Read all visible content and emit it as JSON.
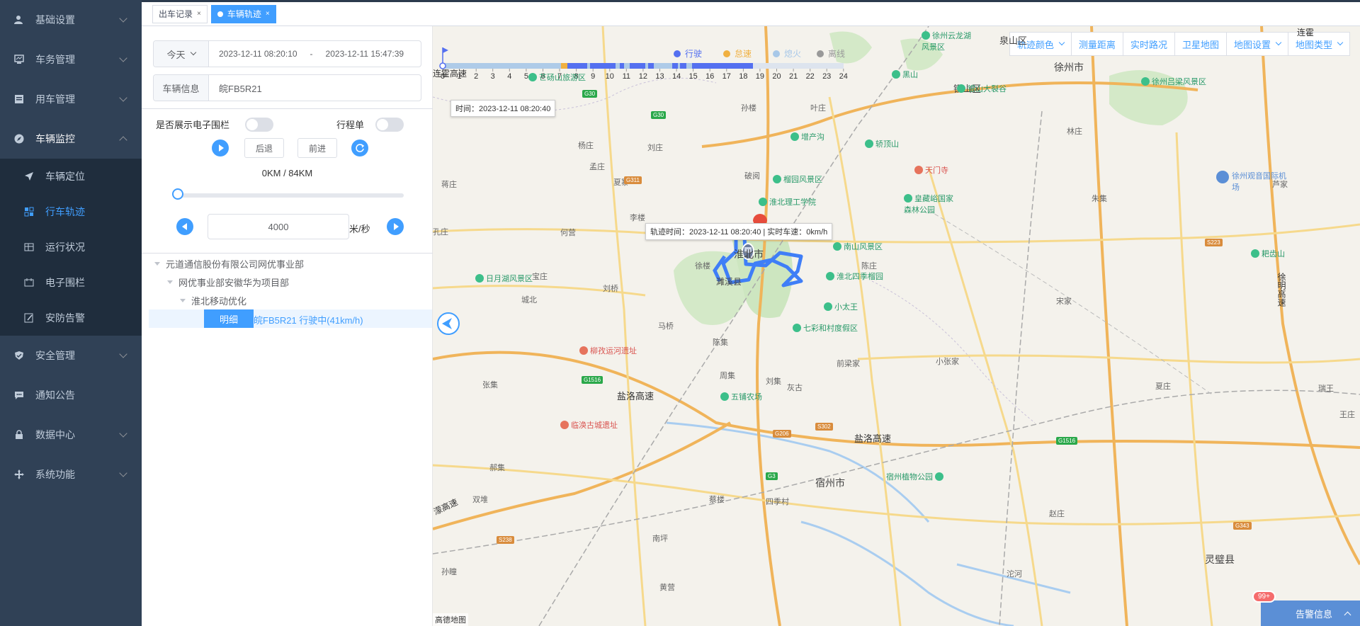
{
  "sidebar": {
    "menu": [
      {
        "label": "基础设置",
        "icon": "user-icon"
      },
      {
        "label": "车务管理",
        "icon": "monitor-icon"
      },
      {
        "label": "用车管理",
        "icon": "document-icon"
      },
      {
        "label": "车辆监控",
        "icon": "compass-icon"
      }
    ],
    "submenu": [
      {
        "label": "车辆定位",
        "icon": "send-icon"
      },
      {
        "label": "行车轨迹",
        "icon": "grid-icon"
      },
      {
        "label": "运行状况",
        "icon": "table-icon"
      },
      {
        "label": "电子围栏",
        "icon": "fence-icon"
      },
      {
        "label": "安防告警",
        "icon": "edit-icon"
      }
    ],
    "menu_bottom": [
      {
        "label": "安全管理",
        "icon": "shield-icon"
      },
      {
        "label": "通知公告",
        "icon": "chat-icon"
      },
      {
        "label": "数据中心",
        "icon": "lock-icon"
      },
      {
        "label": "系统功能",
        "icon": "move-icon"
      }
    ]
  },
  "tabs": [
    {
      "label": "出车记录",
      "close": "×"
    },
    {
      "label": "车辆轨迹",
      "close": "×"
    }
  ],
  "panel": {
    "date_prefix": "今天",
    "date_start": "2023-12-11 08:20:10",
    "date_sep": "-",
    "date_end": "2023-12-11 15:47:39",
    "vehicle_prefix": "车辆信息",
    "vehicle_value": "皖FB5R21",
    "fence_label": "是否展示电子围栏",
    "trip_label": "行程单",
    "back_label": "后退",
    "forward_label": "前进",
    "distance": "0KM / 84KM",
    "speed_value": "4000",
    "speed_unit": "米/秒",
    "tree": {
      "l1": "元道通信股份有限公司网优事业部",
      "l2": "网优事业部安徽华为项目部",
      "l3": "淮北移动优化",
      "detail_btn": "明细",
      "vehicle": "皖FB5R21 行驶中(41km/h)"
    }
  },
  "map": {
    "legend": [
      {
        "label": "行驶",
        "color": "#5470f0"
      },
      {
        "label": "怠速",
        "color": "#f0b040"
      },
      {
        "label": "熄火",
        "color": "#a8c8e8"
      },
      {
        "label": "离线",
        "color": "#999999"
      }
    ],
    "timeline_hours": [
      "0",
      "1",
      "2",
      "3",
      "4",
      "5",
      "6",
      "7",
      "8",
      "9",
      "10",
      "11",
      "12",
      "13",
      "14",
      "15",
      "16",
      "17",
      "18",
      "19",
      "20",
      "21",
      "22",
      "23",
      "24"
    ],
    "current_time_tip": "时间：2023-12-11 08:20:40",
    "track_tip": "轨迹时间：2023-12-11 08:20:40 | 实时车速：0km/h",
    "toolbar": {
      "track_color": "轨迹颜色",
      "measure": "测量距离",
      "traffic": "实时路况",
      "satellite": "卫星地图",
      "settings": "地图设置",
      "map_type": "地图类型"
    },
    "places": {
      "xuzhou": "徐州市",
      "suzhou": "宿州市",
      "huaibei": "淮北市",
      "suixi": "濉溪县",
      "lingbi": "灵璧县",
      "tongshan": "铜山区",
      "quanshan": "泉山区",
      "yanluo1": "盐洛高速",
      "yanluo2": "盐洛高速",
      "xuming": "徐明高速",
      "airport": "徐州观音国际机场",
      "lianhuo": "连霍高速",
      "lianhuo2": "连霍",
      "mengzhou": "濛高速"
    },
    "pois": {
      "p1": "淮北理工学院",
      "p2": "南山风景区",
      "p3": "淮北四季榴园",
      "p4": "小太王",
      "p5": "七彩和村度假区",
      "p6": "五铺农场",
      "p7": "宿州植物公园",
      "p8": "皇藏峪国家森林公园",
      "p9": "日月湖风景区",
      "p10": "柳孜运河遗址",
      "p11": "临涣古城遗址",
      "p12": "天门寺",
      "p13": "徐州吕梁风景区",
      "p14": "银山大裂谷",
      "p15": "榴园风景区",
      "p16": "增产沟",
      "p17": "芒砀山旅游区",
      "p18": "轿顶山",
      "p19": "黑山",
      "p20": "耙齿山",
      "p21": "徐州云龙湖风景区"
    },
    "towns": [
      "孙楼",
      "杨庄",
      "刘庄",
      "孟庄",
      "夏寨",
      "李楼",
      "何营",
      "破阅",
      "徐楼",
      "蒋庄",
      "孔庄",
      "刘集",
      "陈集",
      "郝集",
      "双堆",
      "张集",
      "四季村",
      "沱河",
      "南坪",
      "孙瞳",
      "马桥",
      "宝庄",
      "黄营",
      "叶庄",
      "城北",
      "周集",
      "灰古",
      "刘桥",
      "蔡楼",
      "小张家",
      "前梁家",
      "陈庄",
      "王庄",
      "朱集",
      "芦家",
      "宋家",
      "夏庄",
      "赵庄",
      "瑞王",
      "林庄"
    ],
    "alarm_label": "告警信息",
    "alarm_count": "99+",
    "attribution": "高德地图"
  }
}
